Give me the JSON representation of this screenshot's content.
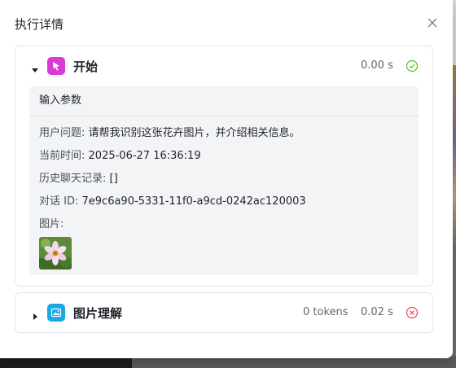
{
  "dialog": {
    "title": "执行详情"
  },
  "nodes": [
    {
      "title": "开始",
      "duration": "0.00 s",
      "status": "success",
      "icon": "pointer-icon",
      "icon_color": "#d63bd3",
      "expanded": true,
      "params": {
        "header": "输入参数",
        "rows": [
          {
            "key": "用户问题:",
            "value": "请帮我识别这张花卉图片，并介绍相关信息。"
          },
          {
            "key": "当前时间:",
            "value": "2025-06-27 16:36:19"
          },
          {
            "key": "历史聊天记录:",
            "value": "[]"
          },
          {
            "key": "对话 ID:",
            "value": "7e9c6a90-5331-11f0-a9cd-0242ac120003"
          },
          {
            "key": "图片:",
            "value": ""
          }
        ]
      }
    },
    {
      "title": "图片理解",
      "tokens": "0 tokens",
      "duration": "0.02 s",
      "status": "error",
      "icon": "image-icon",
      "icon_color": "#1aa7e8",
      "expanded": false
    }
  ],
  "colors": {
    "success": "#52c41a",
    "error": "#f5484a"
  }
}
